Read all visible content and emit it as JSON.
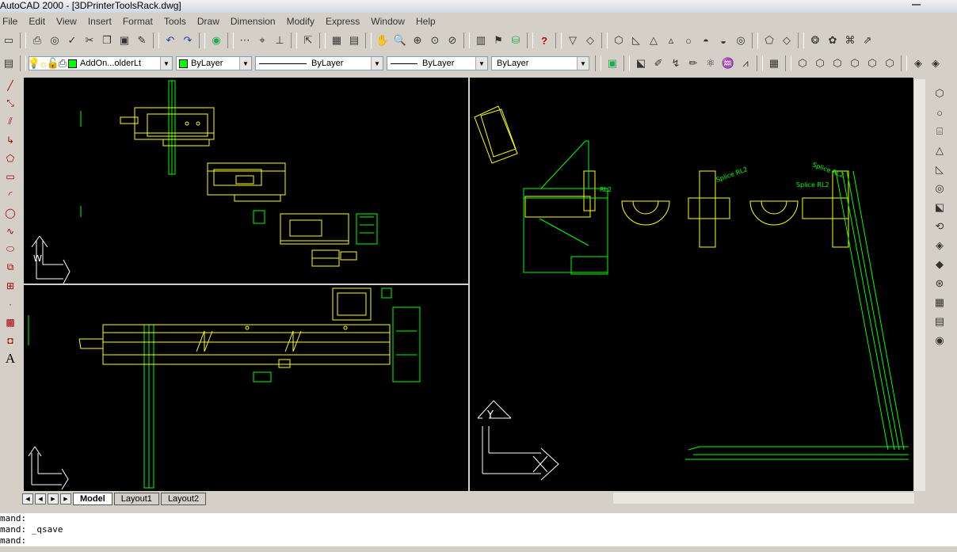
{
  "window": {
    "title": "AutoCAD 2000 - [3DPrinterToolsRack.dwg]",
    "minimize_icon": "minimize-icon"
  },
  "menu": [
    "File",
    "Edit",
    "View",
    "Insert",
    "Format",
    "Tools",
    "Draw",
    "Dimension",
    "Modify",
    "Express",
    "Window",
    "Help"
  ],
  "properties": {
    "layer": "AddOn...olderLt",
    "color": "ByLayer",
    "linetype": "ByLayer",
    "lineweight": "ByLayer",
    "plotstyle": "ByLayer"
  },
  "tabs": [
    "Model",
    "Layout1",
    "Layout2"
  ],
  "command": {
    "lines": [
      "mand:",
      "mand: _qsave",
      "mand:"
    ]
  },
  "ucs": {
    "x": "X",
    "y": "Y",
    "w": "W"
  },
  "annotations": [
    "Splice RL2",
    "Splice RL2",
    "Splice RL2",
    "RL2"
  ],
  "colors": {
    "model_bg": "#000000",
    "yellow": "#ffff00",
    "green": "#00ff00",
    "chrome": "#d4d0c8"
  }
}
